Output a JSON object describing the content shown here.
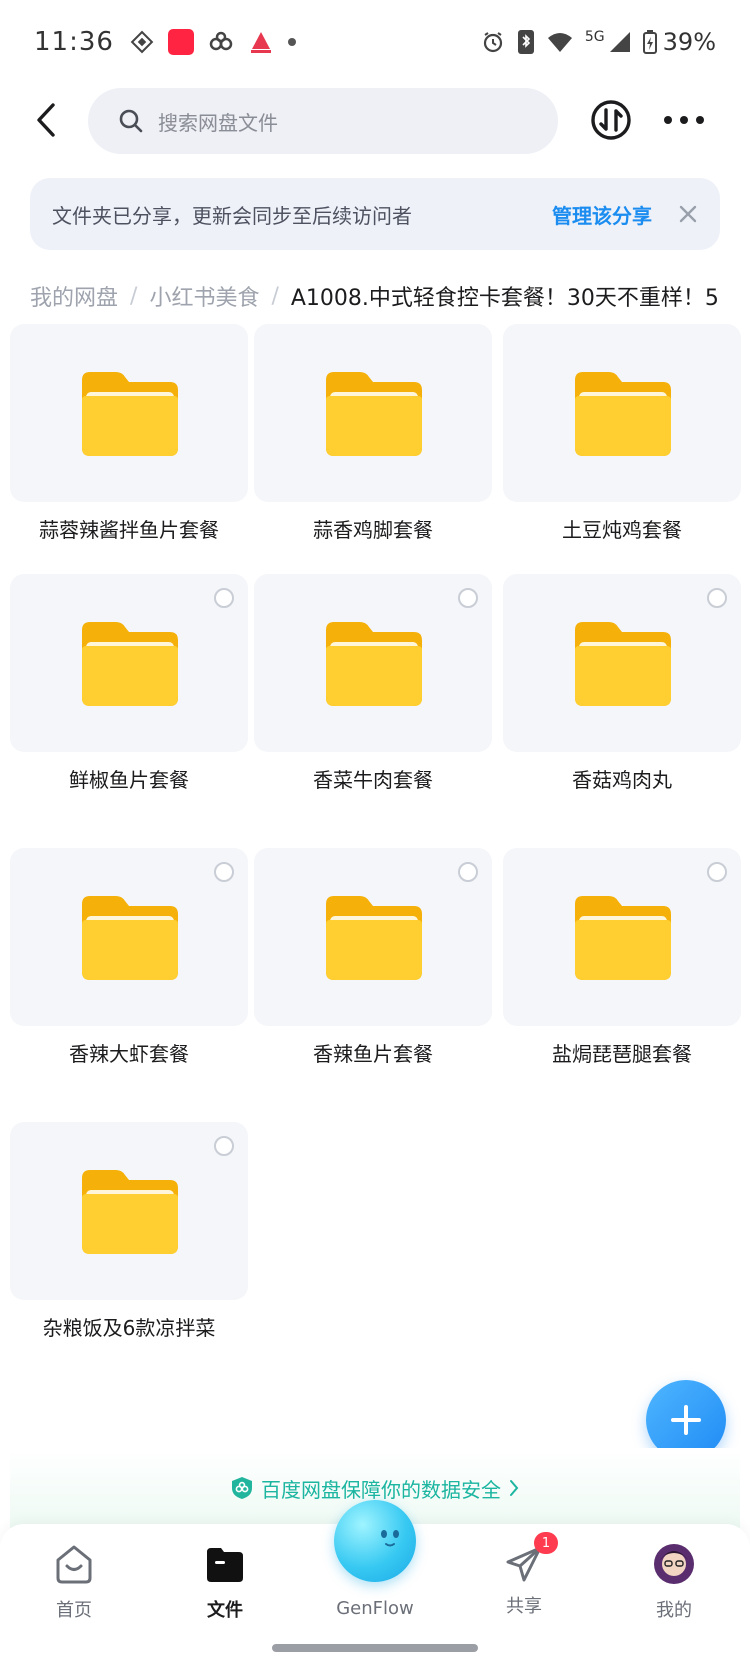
{
  "status_bar": {
    "time": "11:36",
    "battery": "39%",
    "network": "5G"
  },
  "search": {
    "placeholder": "搜索网盘文件"
  },
  "share_notice": {
    "text": "文件夹已分享，更新会同步至后续访问者",
    "action": "管理该分享"
  },
  "breadcrumb": {
    "items": [
      "我的网盘",
      "小红书美食"
    ],
    "current": "A1008.中式轻食控卡套餐！30天不重样！5"
  },
  "folders": [
    "蒜蓉辣酱拌鱼片套餐",
    "蒜香鸡脚套餐",
    "土豆炖鸡套餐",
    "鲜椒鱼片套餐",
    "香菜牛肉套餐",
    "香菇鸡肉丸",
    "香辣大虾套餐",
    "香辣鱼片套餐",
    "盐焗琵琶腿套餐",
    "杂粮饭及6款凉拌菜"
  ],
  "safety_banner": {
    "text": "百度网盘保障你的数据安全"
  },
  "bottom_nav": {
    "items": [
      {
        "label": "首页",
        "icon": "home-icon"
      },
      {
        "label": "文件",
        "icon": "folder-icon"
      },
      {
        "label": "GenFlow",
        "icon": "genflow-icon"
      },
      {
        "label": "共享",
        "icon": "share-icon",
        "badge": "1"
      },
      {
        "label": "我的",
        "icon": "avatar-icon"
      }
    ],
    "active": "文件"
  },
  "colors": {
    "accent": "#1b8cf0",
    "folder": "#ffc927",
    "badge": "#ff3b4f",
    "safety": "#1bb5a0"
  }
}
